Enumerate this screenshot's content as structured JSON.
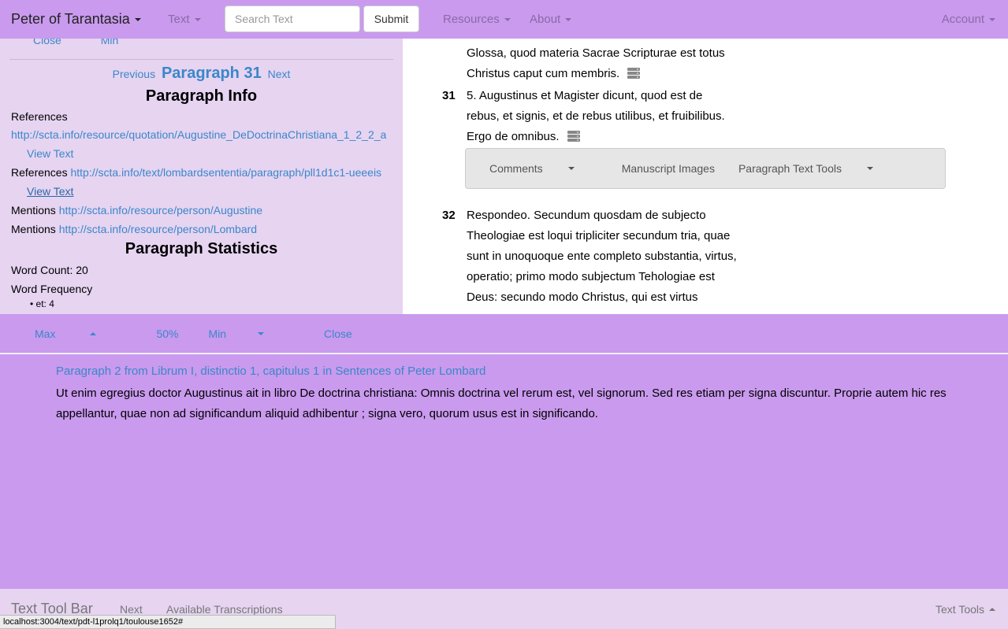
{
  "navbar": {
    "brand": "Peter of Tarantasia",
    "text_menu": "Text",
    "search_placeholder": "Search Text",
    "submit_label": "Submit",
    "resources_menu": "Resources",
    "about_menu": "About",
    "account_menu": "Account"
  },
  "sidebar": {
    "close": "Close",
    "min": "Min",
    "previous": "Previous",
    "paragraph_title": "Paragraph 31",
    "next": "Next",
    "info_heading": "Paragraph Info",
    "ref1_label": "References",
    "ref1_url": "http://scta.info/resource/quotation/Augustine_DeDoctrinaChristiana_1_2_2_a",
    "ref1_view": "View Text",
    "ref2_label": "References",
    "ref2_url": "http://scta.info/text/lombardsententia/paragraph/pll1d1c1-ueeeis",
    "ref2_view": "View Text",
    "mention1_label": "Mentions",
    "mention1_url": "http://scta.info/resource/person/Augustine",
    "mention2_label": "Mentions",
    "mention2_url": "http://scta.info/resource/person/Lombard",
    "stats_heading": "Paragraph Statistics",
    "word_count": "Word Count: 20",
    "word_freq_label": "Word Frequency",
    "word_freq_item": "et: 4"
  },
  "main": {
    "prev_lines": [
      "Glossa, quod materia Sacrae Scripturae est totus",
      "Christus caput cum membris."
    ],
    "para31": {
      "num": "31",
      "lines": [
        "5. Augustinus et Magister dicunt, quod est de",
        "rebus, et signis, et de rebus utilibus, et fruibilibus.",
        "Ergo de omnibus."
      ]
    },
    "toolbar": {
      "comments": "Comments",
      "manuscript_images": "Manuscript Images",
      "paragraph_text_tools": "Paragraph Text Tools"
    },
    "para32": {
      "num": "32",
      "lines": [
        "Respondeo. Secundum quosdam de subjecto",
        "Theologiae est loqui tripliciter secundum tria, quae",
        "sunt in unoquoque ente completo substantia, virtus,",
        "operatio; primo modo subjectum Tehologiae est",
        "Deus: secundo modo Christus, qui est virtus"
      ]
    }
  },
  "bottom_panel": {
    "max": "Max",
    "half": "50%",
    "min": "Min",
    "close": "Close",
    "title": "Paragraph 2 from Librum I, distinctio 1, capitulus 1 in Sentences of Peter Lombard",
    "text": "Ut enim egregius doctor Augustinus ait in libro De doctrina christiana: Omnis doctrina vel rerum est, vel signorum. Sed res etiam per signa discuntur. Proprie autem hic res appellantur, quae non ad significandum aliquid adhibentur ; signa vero, quorum usus est in significando."
  },
  "text_toolbar": {
    "title": "Text Tool Bar",
    "next": "Next",
    "available_transcriptions": "Available Transcriptions",
    "text_tools": "Text Tools"
  },
  "status_url": "localhost:3004/text/pdt-l1prolq1/toulouse1652#",
  "colors": {
    "navbar_bg": "#c99aee",
    "sidebar_bg": "#e6d4f1",
    "link": "#3b87c9"
  }
}
